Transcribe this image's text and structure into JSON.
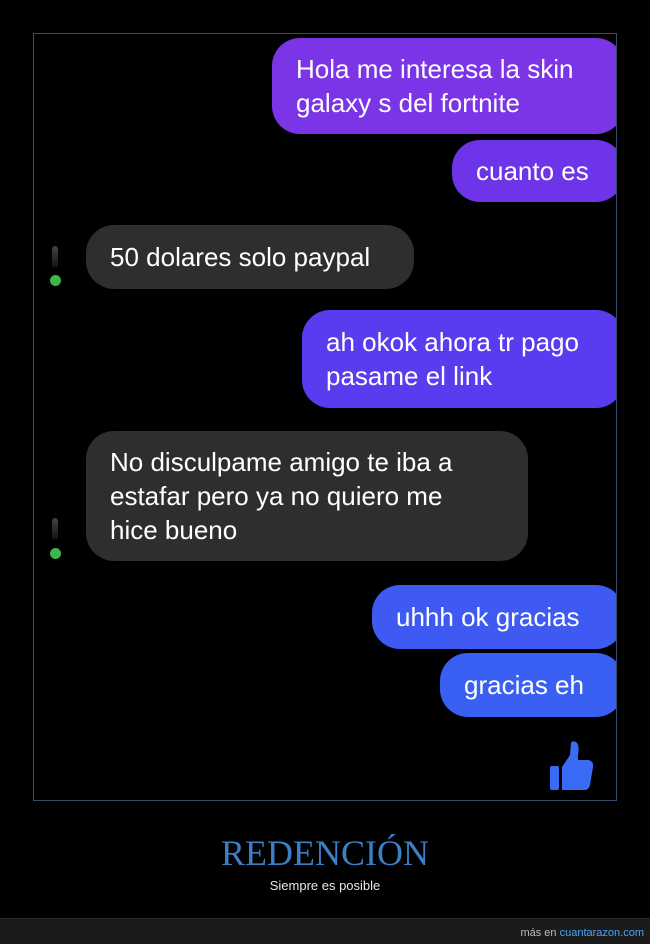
{
  "messages": [
    {
      "from": "me",
      "text": "Hola me interesa la skin galaxy s del fortnite",
      "color": "#7b34e6"
    },
    {
      "from": "me",
      "text": "cuanto es",
      "color": "#6d34ea"
    },
    {
      "from": "them",
      "text": "50 dolares solo paypal"
    },
    {
      "from": "me",
      "text": "ah okok ahora tr pago pasame el link",
      "color": "#5a3bf0"
    },
    {
      "from": "them",
      "text": "No disculpame amigo te iba a estafar pero ya no quiero me hice bueno"
    },
    {
      "from": "me",
      "text": "uhhh ok gracias",
      "color": "#3f5af2"
    },
    {
      "from": "me",
      "text": "gracias eh",
      "color": "#3a5ff3"
    }
  ],
  "like_icon": "thumbs-up-icon",
  "colors": {
    "like": "#3a6bf4",
    "title": "#3d7fc4",
    "online_dot": "#3fb64a"
  },
  "caption": {
    "title": "REDENCIÓN",
    "subtitle": "Siempre es posible"
  },
  "footer": {
    "prefix": "más en",
    "link": "cuantarazon.com"
  }
}
